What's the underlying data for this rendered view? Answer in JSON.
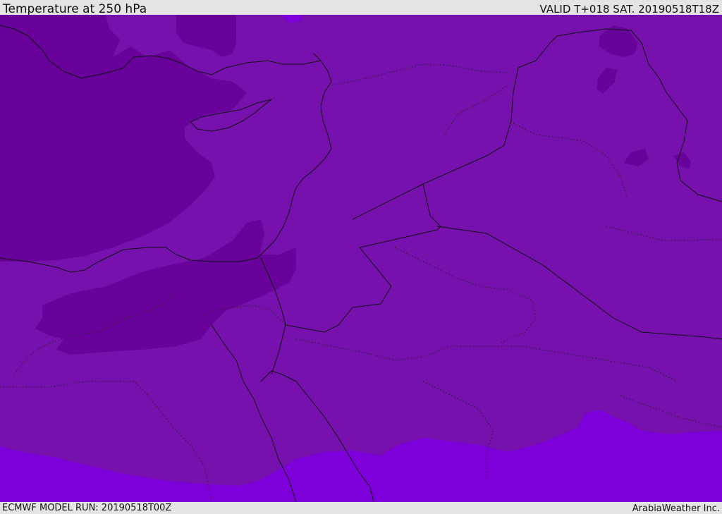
{
  "header": {
    "title": "Temperature at 250 hPa",
    "valid": "VALID T+018 SAT. 20190518T18Z"
  },
  "footer": {
    "model_run": "ECMWF MODEL RUN: 20190518T00Z",
    "credit": "ArabiaWeather Inc."
  },
  "map": {
    "colors": {
      "cold": "#68029a",
      "mid": "#7611ae",
      "warm": "#7d00da",
      "land_outline": "#111111"
    }
  }
}
